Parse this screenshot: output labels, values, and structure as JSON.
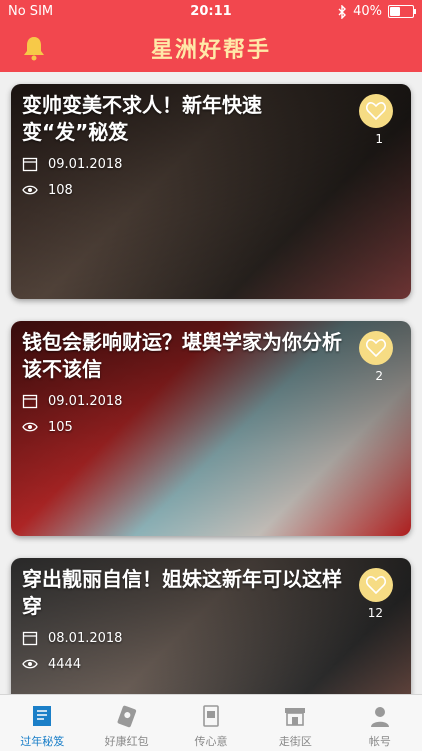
{
  "status": {
    "carrier": "No SIM",
    "time": "20:11",
    "battery": "40%",
    "battery_level": 0.4
  },
  "header": {
    "title": "星洲好帮手"
  },
  "cards": [
    {
      "title": "变帅变美不求人！新年快速变“发”秘笈",
      "date": "09.01.2018",
      "views": "108",
      "likes": "1"
    },
    {
      "title": "钱包会影响财运？堪舆学家为你分析该不该信",
      "date": "09.01.2018",
      "views": "105",
      "likes": "2"
    },
    {
      "title": "穿出靓丽自信！姐妹这新年可以这样穿",
      "date": "08.01.2018",
      "views": "4444",
      "likes": "12"
    }
  ],
  "tabs": [
    {
      "label": "过年秘笈",
      "active": true
    },
    {
      "label": "好康红包",
      "active": false
    },
    {
      "label": "传心意",
      "active": false
    },
    {
      "label": "走街区",
      "active": false
    },
    {
      "label": "帐号",
      "active": false
    }
  ],
  "colors": {
    "accent": "#f2474e",
    "tab_active": "#1b7fc8",
    "like": "#f6dc84"
  }
}
